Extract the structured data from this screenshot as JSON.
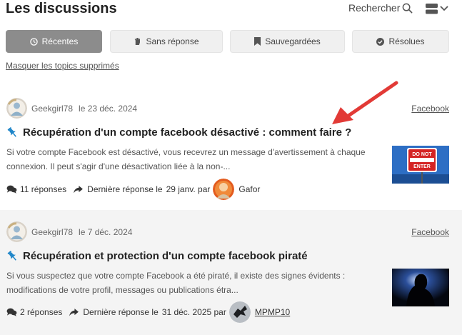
{
  "header": {
    "title": "Les discussions",
    "search_label": "Rechercher"
  },
  "filters": [
    {
      "label": "Récentes",
      "icon": "clock-icon",
      "active": true
    },
    {
      "label": "Sans réponse",
      "icon": "hand-icon",
      "active": false
    },
    {
      "label": "Sauvegardées",
      "icon": "bookmark-icon",
      "active": false
    },
    {
      "label": "Résolues",
      "icon": "check-circle-icon",
      "active": false
    }
  ],
  "mask_link": "Masquer les topics supprimés",
  "topics": [
    {
      "author": "Geekgirl78",
      "date": "le 23 déc. 2024",
      "category": "Facebook",
      "title": "Récupération d'un compte facebook désactivé : comment faire ?",
      "excerpt": "Si votre compte Facebook est désactivé, vous recevrez un message d'avertissement à chaque connexion. Il peut s'agir d'une désactivation liée à la non-...",
      "replies": "11 réponses",
      "last_reply_label": "Dernière réponse le",
      "last_reply_date": "29 janv. par",
      "last_reply_user": "Gafor",
      "thumbnail": {
        "sign_text_1": "DO NOT",
        "sign_text_2": "ENTER"
      }
    },
    {
      "author": "Geekgirl78",
      "date": "le 7 déc. 2024",
      "category": "Facebook",
      "title": "Récupération et protection d'un compte facebook piraté",
      "excerpt": "Si vous suspectez que votre compte Facebook a été piraté, il existe des signes évidents : modifications de votre profil, messages ou publications étra...",
      "replies": "2 réponses",
      "last_reply_label": "Dernière réponse le",
      "last_reply_date": "31 déc. 2025 par",
      "last_reply_user": "MPMP10"
    }
  ],
  "colors": {
    "active_filter": "#8c8c8c",
    "pin": "#1f86c9",
    "arrow": "#e23a36",
    "alt_row": "#f4f4f4"
  }
}
